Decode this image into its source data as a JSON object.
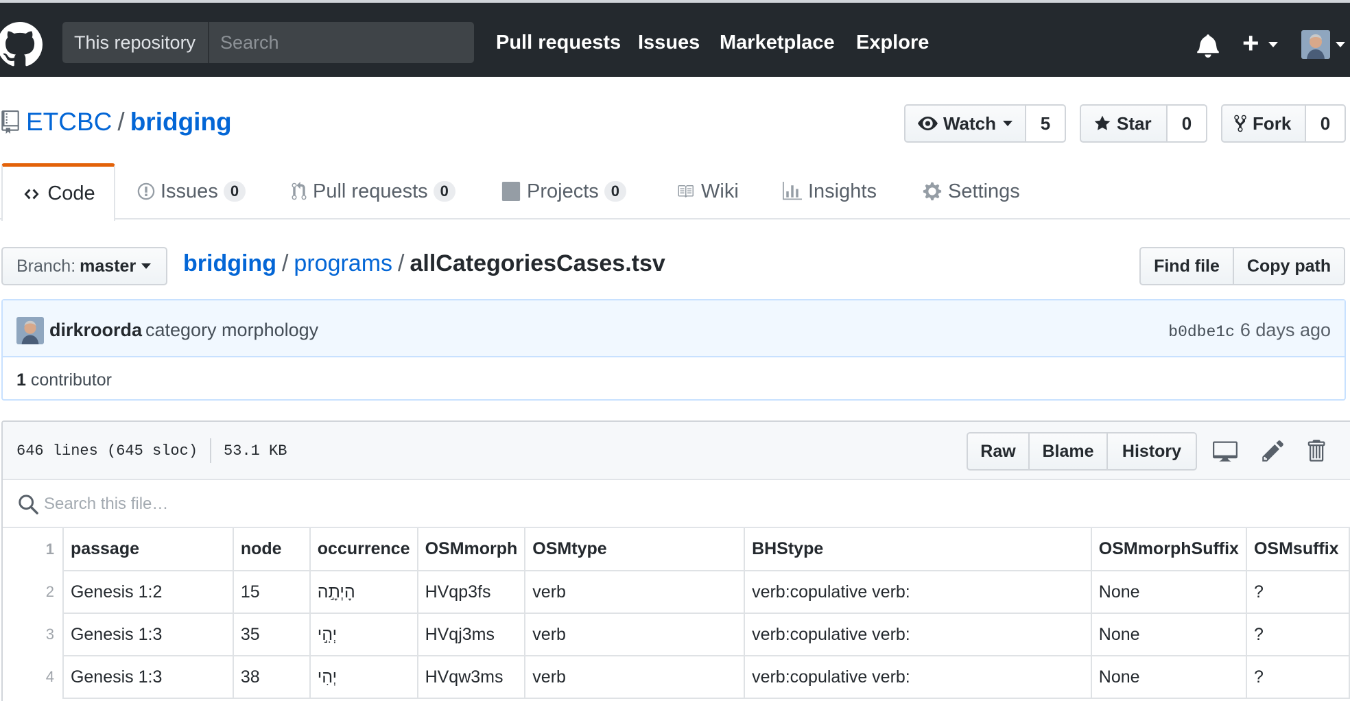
{
  "header": {
    "scope_label": "This repository",
    "search_placeholder": "Search",
    "nav": [
      "Pull requests",
      "Issues",
      "Marketplace",
      "Explore"
    ]
  },
  "repo": {
    "owner": "ETCBC",
    "separator": "/",
    "name": "bridging",
    "watch_label": "Watch",
    "watch_count": "5",
    "star_label": "Star",
    "star_count": "0",
    "fork_label": "Fork",
    "fork_count": "0"
  },
  "tabs": [
    {
      "label": "Code",
      "icon": "code-icon"
    },
    {
      "label": "Issues",
      "count": "0",
      "icon": "issue-icon"
    },
    {
      "label": "Pull requests",
      "count": "0",
      "icon": "pull-request-icon"
    },
    {
      "label": "Projects",
      "count": "0",
      "icon": "project-icon"
    },
    {
      "label": "Wiki",
      "icon": "book-icon"
    },
    {
      "label": "Insights",
      "icon": "graph-icon"
    },
    {
      "label": "Settings",
      "icon": "gear-icon"
    }
  ],
  "file_nav": {
    "branch_label": "Branch:",
    "branch_value": "master",
    "path": [
      "bridging",
      "programs"
    ],
    "separator": "/",
    "file_name": "allCategoriesCases.tsv",
    "find_file": "Find file",
    "copy_path": "Copy path"
  },
  "commit": {
    "author": "dirkroorda",
    "message": "category morphology",
    "sha": "b0dbe1c",
    "age": "6 days ago",
    "contributors_count": "1",
    "contributors_label": "contributor"
  },
  "file": {
    "lines": "646 lines (645 sloc)",
    "size": "53.1 KB",
    "raw": "Raw",
    "blame": "Blame",
    "history": "History",
    "search_placeholder": "Search this file…"
  },
  "table": {
    "header_line": "1",
    "headers": [
      "passage",
      "node",
      "occurrence",
      "OSMmorph",
      "OSMtype",
      "BHStype",
      "OSMmorphSuffix",
      "OSMsuffix"
    ],
    "rows": [
      {
        "line": "2",
        "cells": [
          "Genesis 1:2",
          "15",
          "הָיְתָ֣ה",
          "HVqp3fs",
          "verb",
          "verb:copulative verb:",
          "None",
          "?"
        ]
      },
      {
        "line": "3",
        "cells": [
          "Genesis 1:3",
          "35",
          "יְהִ֣י",
          "HVqj3ms",
          "verb",
          "verb:copulative verb:",
          "None",
          "?"
        ]
      },
      {
        "line": "4",
        "cells": [
          "Genesis 1:3",
          "38",
          "יְהִי",
          "HVqw3ms",
          "verb",
          "verb:copulative verb:",
          "None",
          "?"
        ]
      }
    ]
  },
  "colors": {
    "header_bg": "#24292e",
    "link": "#0366d6",
    "tab_accent": "#e36209",
    "commit_bg": "#f1f8ff"
  }
}
